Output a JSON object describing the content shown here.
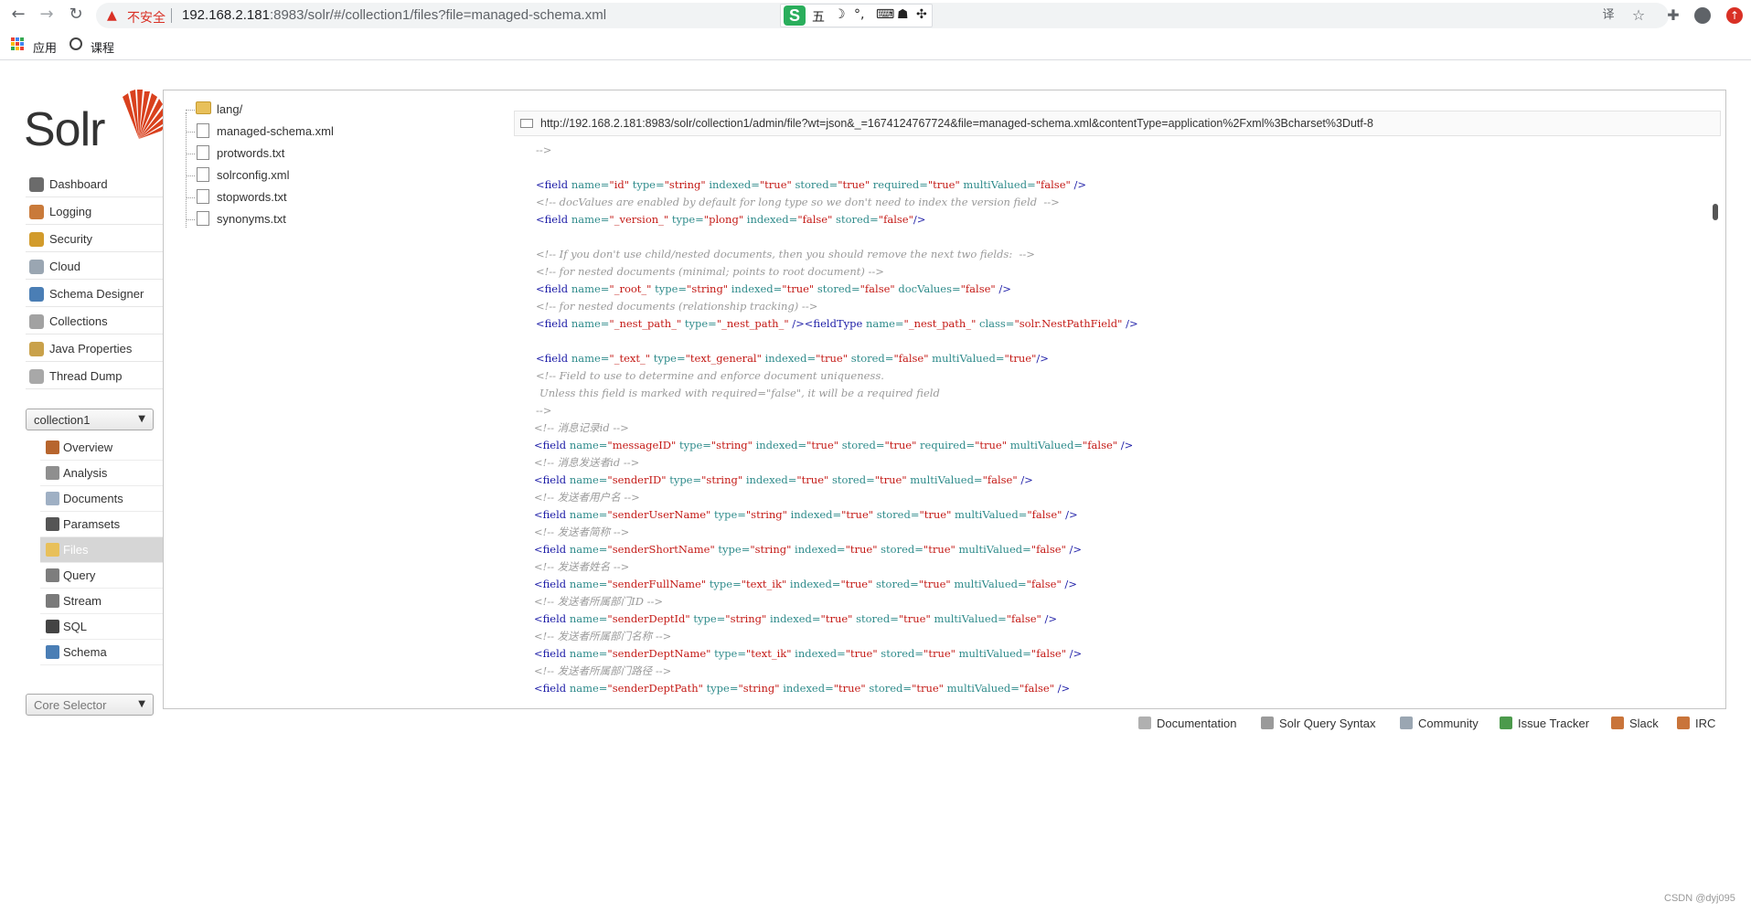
{
  "browser": {
    "insecure_label": "不安全",
    "url_host": "192.168.2.181",
    "url_path": ":8983/solr/#/collection1/files?file=managed-schema.xml",
    "ime_glyph_1": "五",
    "ime_glyph_2": "☽",
    "ime_glyph_3": "°,",
    "ime_glyph_4": "⌨",
    "ime_glyph_5": "☗",
    "ime_glyph_6": "✣",
    "bookmarks": [
      {
        "label": "应用",
        "icon": "apps-grid-icon"
      },
      {
        "label": "课程",
        "icon": "globe-icon"
      }
    ]
  },
  "brand": {
    "name": "Solr",
    "sun_color": "#d9411e"
  },
  "nav": {
    "items": [
      {
        "label": "Dashboard",
        "icon": "dashboard-icon",
        "color": "#6b6b6b"
      },
      {
        "label": "Logging",
        "icon": "logging-icon",
        "color": "#c97a3a"
      },
      {
        "label": "Security",
        "icon": "security-icon",
        "color": "#d29b2b"
      },
      {
        "label": "Cloud",
        "icon": "cloud-icon",
        "color": "#9aa6b2"
      },
      {
        "label": "Schema Designer",
        "icon": "schema-designer-icon",
        "color": "#4a7eb5"
      },
      {
        "label": "Collections",
        "icon": "collections-icon",
        "color": "#a2a2a2"
      },
      {
        "label": "Java Properties",
        "icon": "java-icon",
        "color": "#c9a14a"
      },
      {
        "label": "Thread Dump",
        "icon": "thread-dump-icon",
        "color": "#a8a8a8"
      }
    ],
    "core_select": "collection1",
    "core_items": [
      {
        "label": "Overview",
        "icon": "overview-icon",
        "color": "#b7652d"
      },
      {
        "label": "Analysis",
        "icon": "analysis-icon",
        "color": "#8f8f8f"
      },
      {
        "label": "Documents",
        "icon": "documents-icon",
        "color": "#9fb0c4"
      },
      {
        "label": "Paramsets",
        "icon": "paramsets-icon",
        "color": "#555555"
      },
      {
        "label": "Files",
        "icon": "files-icon",
        "color": "#e8c05a"
      },
      {
        "label": "Query",
        "icon": "query-icon",
        "color": "#7d7d7d"
      },
      {
        "label": "Stream",
        "icon": "stream-icon",
        "color": "#7a7a7a"
      },
      {
        "label": "SQL",
        "icon": "sql-icon",
        "color": "#444444"
      },
      {
        "label": "Schema",
        "icon": "schema-icon",
        "color": "#4a7eb5"
      }
    ],
    "core_selector": "Core Selector"
  },
  "files": {
    "tree": [
      {
        "label": "lang/",
        "kind": "folder"
      },
      {
        "label": "managed-schema.xml",
        "kind": "file"
      },
      {
        "label": "protwords.txt",
        "kind": "file"
      },
      {
        "label": "solrconfig.xml",
        "kind": "file"
      },
      {
        "label": "stopwords.txt",
        "kind": "file"
      },
      {
        "label": "synonyms.txt",
        "kind": "file"
      }
    ],
    "file_url": "http://192.168.2.181:8983/solr/collection1/admin/file?wt=json&_=1674124767724&file=managed-schema.xml&contentType=application%2Fxml%3Bcharset%3Dutf-8"
  },
  "code_lines": [
    {
      "indent": 6,
      "parts": [
        {
          "t": "-->",
          "c": "cm"
        }
      ]
    },
    {
      "indent": 0,
      "parts": []
    },
    {
      "indent": 6,
      "parts": [
        {
          "t": "<field ",
          "c": "tg"
        },
        {
          "t": "name=",
          "c": "at"
        },
        {
          "t": "\"id\" ",
          "c": "vl"
        },
        {
          "t": "type=",
          "c": "at"
        },
        {
          "t": "\"string\" ",
          "c": "vl"
        },
        {
          "t": "indexed=",
          "c": "at"
        },
        {
          "t": "\"true\" ",
          "c": "vl"
        },
        {
          "t": "stored=",
          "c": "at"
        },
        {
          "t": "\"true\" ",
          "c": "vl"
        },
        {
          "t": "required=",
          "c": "at"
        },
        {
          "t": "\"true\" ",
          "c": "vl"
        },
        {
          "t": "multiValued=",
          "c": "at"
        },
        {
          "t": "\"false\" ",
          "c": "vl"
        },
        {
          "t": "/>",
          "c": "tg"
        }
      ]
    },
    {
      "indent": 6,
      "parts": [
        {
          "t": "<!-- docValues are enabled by default for long type so we don't need to index the version field  -->",
          "c": "cm"
        }
      ]
    },
    {
      "indent": 6,
      "parts": [
        {
          "t": "<field ",
          "c": "tg"
        },
        {
          "t": "name=",
          "c": "at"
        },
        {
          "t": "\"_version_\" ",
          "c": "vl"
        },
        {
          "t": "type=",
          "c": "at"
        },
        {
          "t": "\"plong\" ",
          "c": "vl"
        },
        {
          "t": "indexed=",
          "c": "at"
        },
        {
          "t": "\"false\" ",
          "c": "vl"
        },
        {
          "t": "stored=",
          "c": "at"
        },
        {
          "t": "\"false\"",
          "c": "vl"
        },
        {
          "t": "/>",
          "c": "tg"
        }
      ]
    },
    {
      "indent": 0,
      "parts": []
    },
    {
      "indent": 6,
      "parts": [
        {
          "t": "<!-- If you don't use child/nested documents, then you should remove the next two fields:  -->",
          "c": "cm"
        }
      ]
    },
    {
      "indent": 6,
      "parts": [
        {
          "t": "<!-- for nested documents (minimal; points to root document) -->",
          "c": "cm"
        }
      ]
    },
    {
      "indent": 6,
      "parts": [
        {
          "t": "<field ",
          "c": "tg"
        },
        {
          "t": "name=",
          "c": "at"
        },
        {
          "t": "\"_root_\" ",
          "c": "vl"
        },
        {
          "t": "type=",
          "c": "at"
        },
        {
          "t": "\"string\" ",
          "c": "vl"
        },
        {
          "t": "indexed=",
          "c": "at"
        },
        {
          "t": "\"true\" ",
          "c": "vl"
        },
        {
          "t": "stored=",
          "c": "at"
        },
        {
          "t": "\"false\" ",
          "c": "vl"
        },
        {
          "t": "docValues=",
          "c": "at"
        },
        {
          "t": "\"false\" ",
          "c": "vl"
        },
        {
          "t": "/>",
          "c": "tg"
        }
      ]
    },
    {
      "indent": 6,
      "parts": [
        {
          "t": "<!-- for nested documents (relationship tracking) -->",
          "c": "cm"
        }
      ]
    },
    {
      "indent": 6,
      "parts": [
        {
          "t": "<field ",
          "c": "tg"
        },
        {
          "t": "name=",
          "c": "at"
        },
        {
          "t": "\"_nest_path_\" ",
          "c": "vl"
        },
        {
          "t": "type=",
          "c": "at"
        },
        {
          "t": "\"_nest_path_\" ",
          "c": "vl"
        },
        {
          "t": "/><fieldType ",
          "c": "tg"
        },
        {
          "t": "name=",
          "c": "at"
        },
        {
          "t": "\"_nest_path_\" ",
          "c": "vl"
        },
        {
          "t": "class=",
          "c": "at"
        },
        {
          "t": "\"solr.NestPathField\" ",
          "c": "vl"
        },
        {
          "t": "/>",
          "c": "tg"
        }
      ]
    },
    {
      "indent": 0,
      "parts": []
    },
    {
      "indent": 6,
      "parts": [
        {
          "t": "<field ",
          "c": "tg"
        },
        {
          "t": "name=",
          "c": "at"
        },
        {
          "t": "\"_text_\" ",
          "c": "vl"
        },
        {
          "t": "type=",
          "c": "at"
        },
        {
          "t": "\"text_general\" ",
          "c": "vl"
        },
        {
          "t": "indexed=",
          "c": "at"
        },
        {
          "t": "\"true\" ",
          "c": "vl"
        },
        {
          "t": "stored=",
          "c": "at"
        },
        {
          "t": "\"false\" ",
          "c": "vl"
        },
        {
          "t": "multiValued=",
          "c": "at"
        },
        {
          "t": "\"true\"",
          "c": "vl"
        },
        {
          "t": "/>",
          "c": "tg"
        }
      ]
    },
    {
      "indent": 6,
      "parts": [
        {
          "t": "<!-- Field to use to determine and enforce document uniqueness.",
          "c": "cm"
        }
      ]
    },
    {
      "indent": 8,
      "parts": [
        {
          "t": "Unless this field is marked with required=\"false\", it will be a required field",
          "c": "cm"
        }
      ]
    },
    {
      "indent": 6,
      "parts": [
        {
          "t": "-->",
          "c": "cm"
        }
      ]
    },
    {
      "indent": 5,
      "parts": [
        {
          "t": "<!-- 消息记录id -->",
          "c": "cm"
        }
      ]
    },
    {
      "indent": 5,
      "parts": [
        {
          "t": "<field ",
          "c": "tg"
        },
        {
          "t": "name=",
          "c": "at"
        },
        {
          "t": "\"messageID\" ",
          "c": "vl"
        },
        {
          "t": "type=",
          "c": "at"
        },
        {
          "t": "\"string\" ",
          "c": "vl"
        },
        {
          "t": "indexed=",
          "c": "at"
        },
        {
          "t": "\"true\" ",
          "c": "vl"
        },
        {
          "t": "stored=",
          "c": "at"
        },
        {
          "t": "\"true\" ",
          "c": "vl"
        },
        {
          "t": "required=",
          "c": "at"
        },
        {
          "t": "\"true\" ",
          "c": "vl"
        },
        {
          "t": "multiValued=",
          "c": "at"
        },
        {
          "t": "\"false\" ",
          "c": "vl"
        },
        {
          "t": "/>",
          "c": "tg"
        }
      ]
    },
    {
      "indent": 5,
      "parts": [
        {
          "t": "<!-- 消息发送者id -->",
          "c": "cm"
        }
      ]
    },
    {
      "indent": 5,
      "parts": [
        {
          "t": "<field ",
          "c": "tg"
        },
        {
          "t": "name=",
          "c": "at"
        },
        {
          "t": "\"senderID\" ",
          "c": "vl"
        },
        {
          "t": "type=",
          "c": "at"
        },
        {
          "t": "\"string\" ",
          "c": "vl"
        },
        {
          "t": "indexed=",
          "c": "at"
        },
        {
          "t": "\"true\" ",
          "c": "vl"
        },
        {
          "t": "stored=",
          "c": "at"
        },
        {
          "t": "\"true\" ",
          "c": "vl"
        },
        {
          "t": "multiValued=",
          "c": "at"
        },
        {
          "t": "\"false\" ",
          "c": "vl"
        },
        {
          "t": "/>",
          "c": "tg"
        }
      ]
    },
    {
      "indent": 5,
      "parts": [
        {
          "t": "<!-- 发送者用户名 -->",
          "c": "cm"
        }
      ]
    },
    {
      "indent": 5,
      "parts": [
        {
          "t": "<field ",
          "c": "tg"
        },
        {
          "t": "name=",
          "c": "at"
        },
        {
          "t": "\"senderUserName\" ",
          "c": "vl"
        },
        {
          "t": "type=",
          "c": "at"
        },
        {
          "t": "\"string\" ",
          "c": "vl"
        },
        {
          "t": "indexed=",
          "c": "at"
        },
        {
          "t": "\"true\" ",
          "c": "vl"
        },
        {
          "t": "stored=",
          "c": "at"
        },
        {
          "t": "\"true\" ",
          "c": "vl"
        },
        {
          "t": "multiValued=",
          "c": "at"
        },
        {
          "t": "\"false\" ",
          "c": "vl"
        },
        {
          "t": "/>",
          "c": "tg"
        }
      ]
    },
    {
      "indent": 5,
      "parts": [
        {
          "t": "<!-- 发送者简称 -->",
          "c": "cm"
        }
      ]
    },
    {
      "indent": 5,
      "parts": [
        {
          "t": "<field ",
          "c": "tg"
        },
        {
          "t": "name=",
          "c": "at"
        },
        {
          "t": "\"senderShortName\" ",
          "c": "vl"
        },
        {
          "t": "type=",
          "c": "at"
        },
        {
          "t": "\"string\" ",
          "c": "vl"
        },
        {
          "t": "indexed=",
          "c": "at"
        },
        {
          "t": "\"true\" ",
          "c": "vl"
        },
        {
          "t": "stored=",
          "c": "at"
        },
        {
          "t": "\"true\" ",
          "c": "vl"
        },
        {
          "t": "multiValued=",
          "c": "at"
        },
        {
          "t": "\"false\" ",
          "c": "vl"
        },
        {
          "t": "/>",
          "c": "tg"
        }
      ]
    },
    {
      "indent": 5,
      "parts": [
        {
          "t": "<!-- 发送者姓名 -->",
          "c": "cm"
        }
      ]
    },
    {
      "indent": 5,
      "parts": [
        {
          "t": "<field ",
          "c": "tg"
        },
        {
          "t": "name=",
          "c": "at"
        },
        {
          "t": "\"senderFullName\" ",
          "c": "vl"
        },
        {
          "t": "type=",
          "c": "at"
        },
        {
          "t": "\"text_ik\" ",
          "c": "vl"
        },
        {
          "t": "indexed=",
          "c": "at"
        },
        {
          "t": "\"true\" ",
          "c": "vl"
        },
        {
          "t": "stored=",
          "c": "at"
        },
        {
          "t": "\"true\" ",
          "c": "vl"
        },
        {
          "t": "multiValued=",
          "c": "at"
        },
        {
          "t": "\"false\" ",
          "c": "vl"
        },
        {
          "t": "/>",
          "c": "tg"
        }
      ]
    },
    {
      "indent": 5,
      "parts": [
        {
          "t": "<!-- 发送者所属部门ID -->",
          "c": "cm"
        }
      ]
    },
    {
      "indent": 5,
      "parts": [
        {
          "t": "<field ",
          "c": "tg"
        },
        {
          "t": "name=",
          "c": "at"
        },
        {
          "t": "\"senderDeptId\" ",
          "c": "vl"
        },
        {
          "t": "type=",
          "c": "at"
        },
        {
          "t": "\"string\" ",
          "c": "vl"
        },
        {
          "t": "indexed=",
          "c": "at"
        },
        {
          "t": "\"true\" ",
          "c": "vl"
        },
        {
          "t": "stored=",
          "c": "at"
        },
        {
          "t": "\"true\" ",
          "c": "vl"
        },
        {
          "t": "multiValued=",
          "c": "at"
        },
        {
          "t": "\"false\" ",
          "c": "vl"
        },
        {
          "t": "/>",
          "c": "tg"
        }
      ]
    },
    {
      "indent": 5,
      "parts": [
        {
          "t": "<!-- 发送者所属部门名称 -->",
          "c": "cm"
        }
      ]
    },
    {
      "indent": 5,
      "parts": [
        {
          "t": "<field ",
          "c": "tg"
        },
        {
          "t": "name=",
          "c": "at"
        },
        {
          "t": "\"senderDeptName\" ",
          "c": "vl"
        },
        {
          "t": "type=",
          "c": "at"
        },
        {
          "t": "\"text_ik\" ",
          "c": "vl"
        },
        {
          "t": "indexed=",
          "c": "at"
        },
        {
          "t": "\"true\" ",
          "c": "vl"
        },
        {
          "t": "stored=",
          "c": "at"
        },
        {
          "t": "\"true\" ",
          "c": "vl"
        },
        {
          "t": "multiValued=",
          "c": "at"
        },
        {
          "t": "\"false\" ",
          "c": "vl"
        },
        {
          "t": "/>",
          "c": "tg"
        }
      ]
    },
    {
      "indent": 5,
      "parts": [
        {
          "t": "<!-- 发送者所属部门路径 -->",
          "c": "cm"
        }
      ]
    },
    {
      "indent": 5,
      "parts": [
        {
          "t": "<field ",
          "c": "tg"
        },
        {
          "t": "name=",
          "c": "at"
        },
        {
          "t": "\"senderDeptPath\" ",
          "c": "vl"
        },
        {
          "t": "type=",
          "c": "at"
        },
        {
          "t": "\"string\" ",
          "c": "vl"
        },
        {
          "t": "indexed=",
          "c": "at"
        },
        {
          "t": "\"true\" ",
          "c": "vl"
        },
        {
          "t": "stored=",
          "c": "at"
        },
        {
          "t": "\"true\" ",
          "c": "vl"
        },
        {
          "t": "multiValued=",
          "c": "at"
        },
        {
          "t": "\"false\" ",
          "c": "vl"
        },
        {
          "t": "/>",
          "c": "tg"
        }
      ]
    }
  ],
  "footer": {
    "links": [
      {
        "label": "Documentation",
        "icon": "documentation-icon",
        "color": "#b0b0b0"
      },
      {
        "label": "Solr Query Syntax",
        "icon": "query-syntax-icon",
        "color": "#9a9a9a"
      },
      {
        "label": "Community",
        "icon": "community-icon",
        "color": "#9aa6b2"
      },
      {
        "label": "Issue Tracker",
        "icon": "issue-tracker-icon",
        "color": "#4c9a4c"
      },
      {
        "label": "Slack",
        "icon": "slack-icon",
        "color": "#c9743a"
      },
      {
        "label": "IRC",
        "icon": "irc-icon",
        "color": "#c9743a"
      }
    ]
  },
  "watermark": "CSDN @dyj095"
}
